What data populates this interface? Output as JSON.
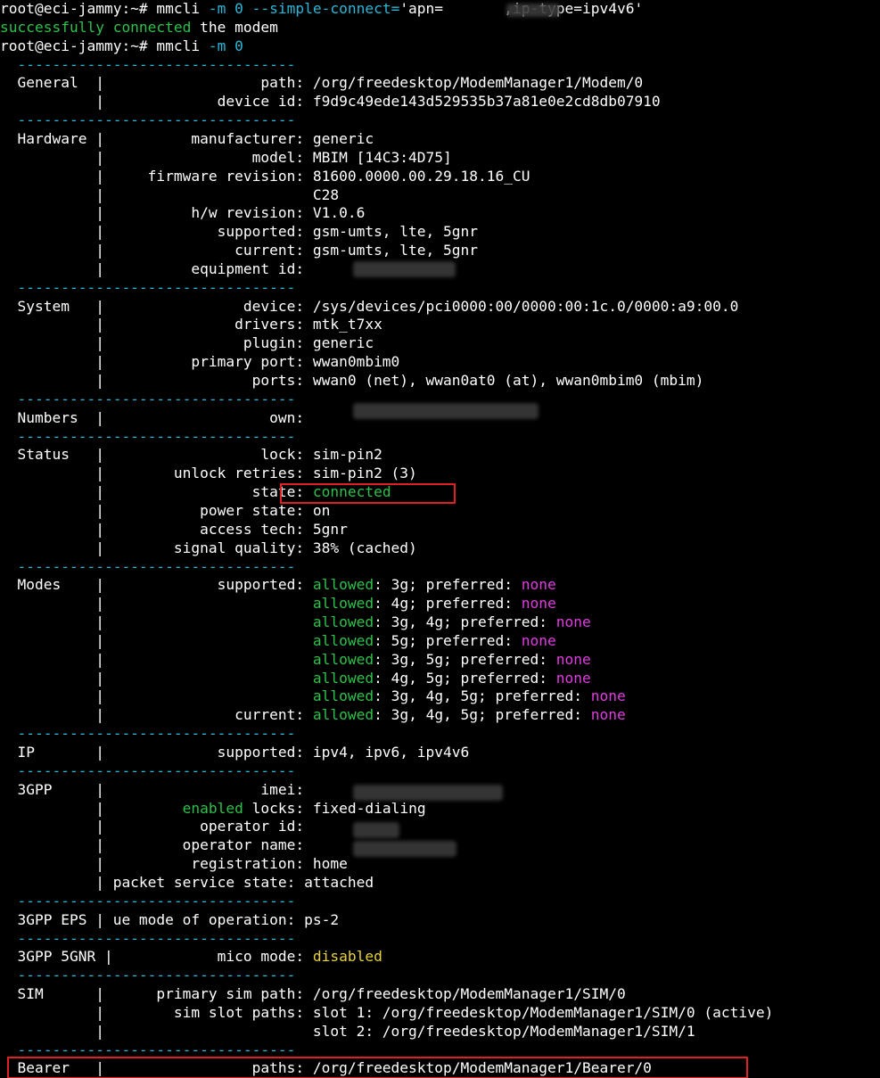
{
  "terminal": {
    "lines": [
      [
        {
          "t": "root@eci-jammy:~# mmcli ",
          "c": "default"
        },
        {
          "t": "-m 0 --simple-connect=",
          "c": "cyan"
        },
        {
          "t": "'apn=       ,ip-type=ipv4v6'",
          "c": "default"
        }
      ],
      [
        {
          "t": "successfully connected",
          "c": "green"
        },
        {
          "t": " the modem",
          "c": "default"
        }
      ],
      [
        {
          "t": "root@eci-jammy:~# mmcli ",
          "c": "default"
        },
        {
          "t": "-m 0",
          "c": "cyan"
        }
      ],
      [
        {
          "t": "  --------------------------------",
          "c": "cyan"
        }
      ],
      [
        {
          "t": "  General  |                  path: /org/freedesktop/ModemManager1/Modem/0",
          "c": "default"
        }
      ],
      [
        {
          "t": "           |             device id: f9d9c49ede143d529535b37a81e0e2cd8db07910",
          "c": "default"
        }
      ],
      [
        {
          "t": "  --------------------------------",
          "c": "cyan"
        }
      ],
      [
        {
          "t": "  Hardware |          manufacturer: generic",
          "c": "default"
        }
      ],
      [
        {
          "t": "           |                 model: MBIM [14C3:4D75]",
          "c": "default"
        }
      ],
      [
        {
          "t": "           |     firmware revision: 81600.0000.00.29.18.16_CU",
          "c": "default"
        }
      ],
      [
        {
          "t": "           |                        C28",
          "c": "default"
        }
      ],
      [
        {
          "t": "           |          h/w revision: V1.0.6",
          "c": "default"
        }
      ],
      [
        {
          "t": "           |             supported: gsm-umts, lte, 5gnr",
          "c": "default"
        }
      ],
      [
        {
          "t": "           |               current: gsm-umts, lte, 5gnr",
          "c": "default"
        }
      ],
      [
        {
          "t": "           |          equipment id:",
          "c": "default"
        }
      ],
      [
        {
          "t": "  --------------------------------",
          "c": "cyan"
        }
      ],
      [
        {
          "t": "  System   |                device: /sys/devices/pci0000:00/0000:00:1c.0/0000:a9:00.0",
          "c": "default"
        }
      ],
      [
        {
          "t": "           |               drivers: mtk_t7xx",
          "c": "default"
        }
      ],
      [
        {
          "t": "           |                plugin: generic",
          "c": "default"
        }
      ],
      [
        {
          "t": "           |          primary port: wwan0mbim0",
          "c": "default"
        }
      ],
      [
        {
          "t": "           |                 ports: wwan0 (net), wwan0at0 (at), wwan0mbim0 (mbim)",
          "c": "default"
        }
      ],
      [
        {
          "t": "  --------------------------------",
          "c": "cyan"
        }
      ],
      [
        {
          "t": "  Numbers  |                   own:",
          "c": "default"
        }
      ],
      [
        {
          "t": "  --------------------------------",
          "c": "cyan"
        }
      ],
      [
        {
          "t": "  Status   |                  lock: sim-pin2",
          "c": "default"
        }
      ],
      [
        {
          "t": "           |        unlock retries: sim-pin2 (3)",
          "c": "default"
        }
      ],
      [
        {
          "t": "           |                 state: ",
          "c": "default"
        },
        {
          "t": "connected",
          "c": "green"
        }
      ],
      [
        {
          "t": "           |           power state: on",
          "c": "default"
        }
      ],
      [
        {
          "t": "           |           access tech: 5gnr",
          "c": "default"
        }
      ],
      [
        {
          "t": "           |        signal quality: 38% (cached)",
          "c": "default"
        }
      ],
      [
        {
          "t": "  --------------------------------",
          "c": "cyan"
        }
      ],
      [
        {
          "t": "  Modes    |             supported: ",
          "c": "default"
        },
        {
          "t": "allowed",
          "c": "green"
        },
        {
          "t": ": 3g; preferred: ",
          "c": "default"
        },
        {
          "t": "none",
          "c": "magenta"
        }
      ],
      [
        {
          "t": "           |                        ",
          "c": "default"
        },
        {
          "t": "allowed",
          "c": "green"
        },
        {
          "t": ": 4g; preferred: ",
          "c": "default"
        },
        {
          "t": "none",
          "c": "magenta"
        }
      ],
      [
        {
          "t": "           |                        ",
          "c": "default"
        },
        {
          "t": "allowed",
          "c": "green"
        },
        {
          "t": ": 3g, 4g; preferred: ",
          "c": "default"
        },
        {
          "t": "none",
          "c": "magenta"
        }
      ],
      [
        {
          "t": "           |                        ",
          "c": "default"
        },
        {
          "t": "allowed",
          "c": "green"
        },
        {
          "t": ": 5g; preferred: ",
          "c": "default"
        },
        {
          "t": "none",
          "c": "magenta"
        }
      ],
      [
        {
          "t": "           |                        ",
          "c": "default"
        },
        {
          "t": "allowed",
          "c": "green"
        },
        {
          "t": ": 3g, 5g; preferred: ",
          "c": "default"
        },
        {
          "t": "none",
          "c": "magenta"
        }
      ],
      [
        {
          "t": "           |                        ",
          "c": "default"
        },
        {
          "t": "allowed",
          "c": "green"
        },
        {
          "t": ": 4g, 5g; preferred: ",
          "c": "default"
        },
        {
          "t": "none",
          "c": "magenta"
        }
      ],
      [
        {
          "t": "           |                        ",
          "c": "default"
        },
        {
          "t": "allowed",
          "c": "green"
        },
        {
          "t": ": 3g, 4g, 5g; preferred: ",
          "c": "default"
        },
        {
          "t": "none",
          "c": "magenta"
        }
      ],
      [
        {
          "t": "           |               current: ",
          "c": "default"
        },
        {
          "t": "allowed",
          "c": "green"
        },
        {
          "t": ": 3g, 4g, 5g; preferred: ",
          "c": "default"
        },
        {
          "t": "none",
          "c": "magenta"
        }
      ],
      [
        {
          "t": "  --------------------------------",
          "c": "cyan"
        }
      ],
      [
        {
          "t": "  IP       |             supported: ipv4, ipv6, ipv4v6",
          "c": "default"
        }
      ],
      [
        {
          "t": "  --------------------------------",
          "c": "cyan"
        }
      ],
      [
        {
          "t": "  3GPP     |                  imei:",
          "c": "default"
        }
      ],
      [
        {
          "t": "           |         ",
          "c": "default"
        },
        {
          "t": "enabled",
          "c": "green"
        },
        {
          "t": " locks: fixed-dialing",
          "c": "default"
        }
      ],
      [
        {
          "t": "           |           operator id:",
          "c": "default"
        }
      ],
      [
        {
          "t": "           |         operator name:",
          "c": "default"
        }
      ],
      [
        {
          "t": "           |          registration: home",
          "c": "default"
        }
      ],
      [
        {
          "t": "           | packet service state: attached",
          "c": "default"
        }
      ],
      [
        {
          "t": "  --------------------------------",
          "c": "cyan"
        }
      ],
      [
        {
          "t": "  3GPP EPS | ue mode of operation: ps-2",
          "c": "default"
        }
      ],
      [
        {
          "t": "  --------------------------------",
          "c": "cyan"
        }
      ],
      [
        {
          "t": "  3GPP 5GNR |            mico mode: ",
          "c": "default"
        },
        {
          "t": "disabled",
          "c": "yellow"
        }
      ],
      [
        {
          "t": "  --------------------------------",
          "c": "cyan"
        }
      ],
      [
        {
          "t": "  SIM      |      primary sim path: /org/freedesktop/ModemManager1/SIM/0",
          "c": "default"
        }
      ],
      [
        {
          "t": "           |        sim slot paths: slot 1: /org/freedesktop/ModemManager1/SIM/0 (active)",
          "c": "default"
        }
      ],
      [
        {
          "t": "           |                        slot 2: /org/freedesktop/ModemManager1/SIM/1",
          "c": "default"
        }
      ],
      [
        {
          "t": "  --------------------------------",
          "c": "cyan"
        }
      ],
      [
        {
          "t": "  Bearer   |                 paths: /org/freedesktop/ModemManager1/Bearer/0",
          "c": "default"
        }
      ]
    ]
  },
  "colors": {
    "background": "#000000",
    "default": "#ffffff",
    "cyan": "#2ab7d9",
    "green": "#2cc24a",
    "magenta": "#e03ce0",
    "yellow": "#e8d23a",
    "highlight_border": "#e02020"
  }
}
